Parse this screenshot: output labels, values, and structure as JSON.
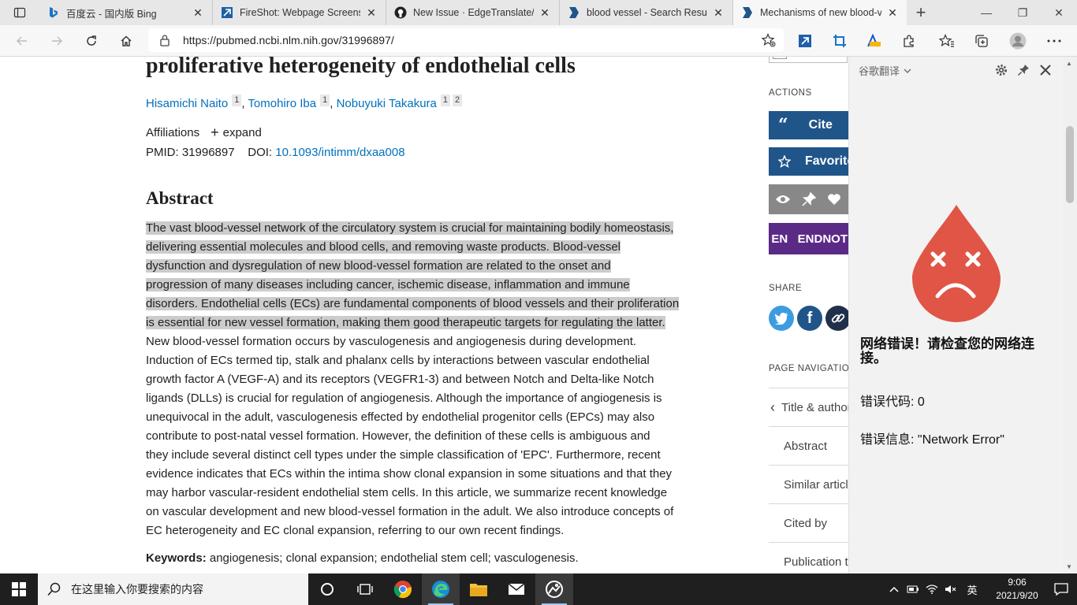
{
  "browser": {
    "tabs": [
      {
        "title": "百度云 - 国内版 Bing",
        "favicon": "bing-icon"
      },
      {
        "title": "FireShot: Webpage Screensho",
        "favicon": "fireshot-icon"
      },
      {
        "title": "New Issue · EdgeTranslate/Ed",
        "favicon": "github-icon"
      },
      {
        "title": "blood vessel - Search Results",
        "favicon": "pubmed-icon"
      },
      {
        "title": "Mechanisms of new blood-ve",
        "favicon": "pubmed-icon"
      }
    ],
    "url": "https://pubmed.ncbi.nlm.nih.gov/31996897/"
  },
  "article": {
    "title": "proliferative heterogeneity of endothelial cells",
    "authors": [
      {
        "name": "Hisamichi Naito",
        "aff": [
          "1"
        ]
      },
      {
        "name": "Tomohiro Iba",
        "aff": [
          "1"
        ]
      },
      {
        "name": "Nobuyuki Takakura",
        "aff": [
          "1",
          "2"
        ]
      }
    ],
    "affiliations_label": "Affiliations",
    "expand_label": "expand",
    "pmid_label": "PMID: 31996897",
    "doi_label": "DOI:",
    "doi": "10.1093/intimm/dxaa008",
    "abstract_heading": "Abstract",
    "abstract_lines": [
      "The vast blood-vessel network of the circulatory system is crucial for maintaining bodily homeostasis,",
      "delivering essential molecules and blood cells, and removing waste products. Blood-vessel",
      "dysfunction and dysregulation of new blood-vessel formation are related to the onset and",
      "progression of many diseases including cancer, ischemic disease, inflammation and immune",
      "disorders. Endothelial cells (ECs) are fundamental components of blood vessels and their proliferation",
      "is essential for new vessel formation, making them good therapeutic targets for regulating the latter.",
      "New blood-vessel formation occurs by vasculogenesis and angiogenesis during development.",
      "Induction of ECs termed tip, stalk and phalanx cells by interactions between vascular endothelial",
      "growth factor A (VEGF-A) and its receptors (VEGFR1-3) and between Notch and Delta-like Notch",
      "ligands (DLLs) is crucial for regulation of angiogenesis. Although the importance of angiogenesis is",
      "unequivocal in the adult, vasculogenesis effected by endothelial progenitor cells (EPCs) may also",
      "contribute to post-natal vessel formation. However, the definition of these cells is ambiguous and",
      "they include several distinct cell types under the simple classification of 'EPC'. Furthermore, recent",
      "evidence indicates that ECs within the intima show clonal expansion in some situations and that they",
      "may harbor vascular-resident endothelial stem cells. In this article, we summarize recent knowledge",
      "on vascular development and new blood-vessel formation in the adult. We also introduce concepts of",
      "EC heterogeneity and EC clonal expansion, referring to our own recent findings."
    ],
    "highlighted_line_count": 6,
    "keywords_label": "Keywords:",
    "keywords": "angiogenesis; clonal expansion; endothelial stem cell; vasculogenesis."
  },
  "sidebar": {
    "actions_label": "ACTIONS",
    "cite_label": "Cite",
    "favorites_label": "Favorites",
    "endnote_badge": "EN",
    "endnote_label": "ENDNOTE",
    "share_label": "SHARE",
    "page_nav_label": "PAGE NAVIGATION",
    "page_nav_items": [
      "Title & authors",
      "Abstract",
      "Similar articles",
      "Cited by",
      "Publication types"
    ]
  },
  "translate_panel": {
    "header": "谷歌翻译",
    "error_title": "网络错误！请检查您的网络连接。",
    "error_code": "错误代码: 0",
    "error_message": "错误信息: \"Network Error\"",
    "colors": {
      "drop": "#e05545",
      "panel_bg": "#f2f2f2"
    }
  },
  "taskbar": {
    "search_placeholder": "在这里输入你要搜索的内容",
    "ime": "英",
    "time": "9:06",
    "date": "2021/9/20"
  },
  "colors": {
    "link": "#0071bc",
    "highlight": "#cccccc",
    "button_blue": "#20558a"
  }
}
